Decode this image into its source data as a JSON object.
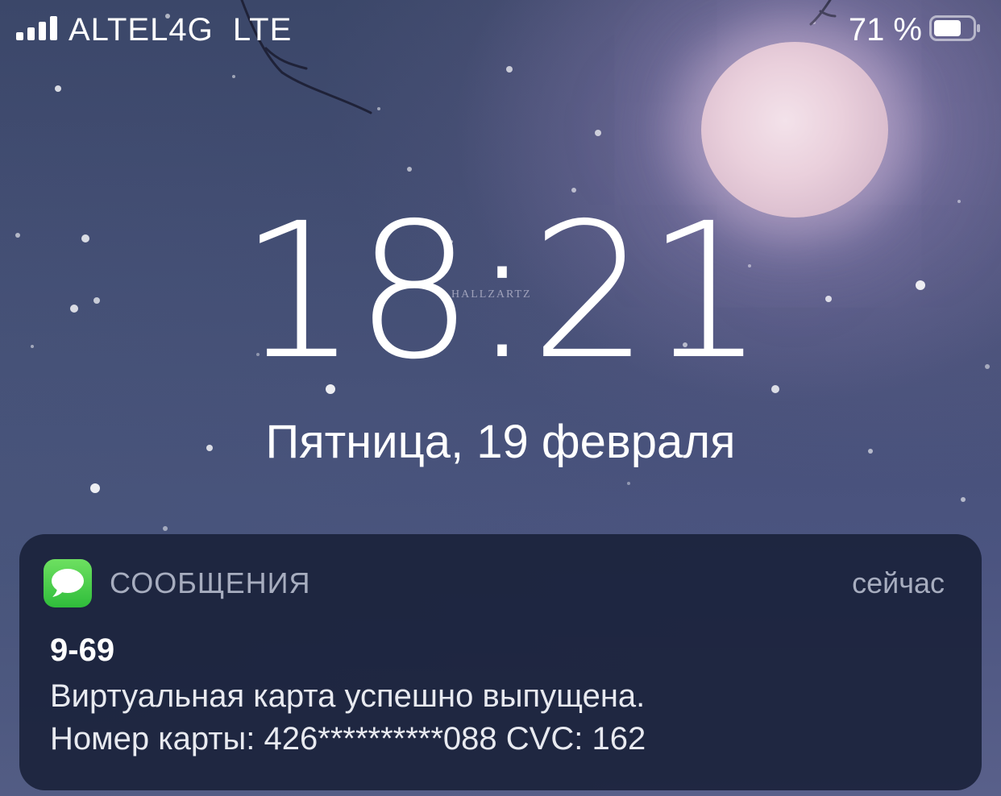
{
  "status_bar": {
    "carrier": "ALTEL4G  LTE",
    "battery_percent": "71 %",
    "signal_bars": 4,
    "battery_level": 0.71
  },
  "lock_screen": {
    "time": "18:21",
    "date": "Пятница, 19 февраля",
    "wallpaper_watermark": "HALLZARTZ"
  },
  "notification": {
    "app_icon": "messages-icon",
    "app_name": "СООБЩЕНИЯ",
    "time": "сейчас",
    "sender": "9-69",
    "body_line1": "Виртуальная карта успешно выпущена.",
    "body_line2": "Номер карты: 426**********088 CVC: 162"
  },
  "colors": {
    "messages_green": "#34c759",
    "notification_bg": "#1a213a",
    "secondary_text": "#a7adbf"
  }
}
